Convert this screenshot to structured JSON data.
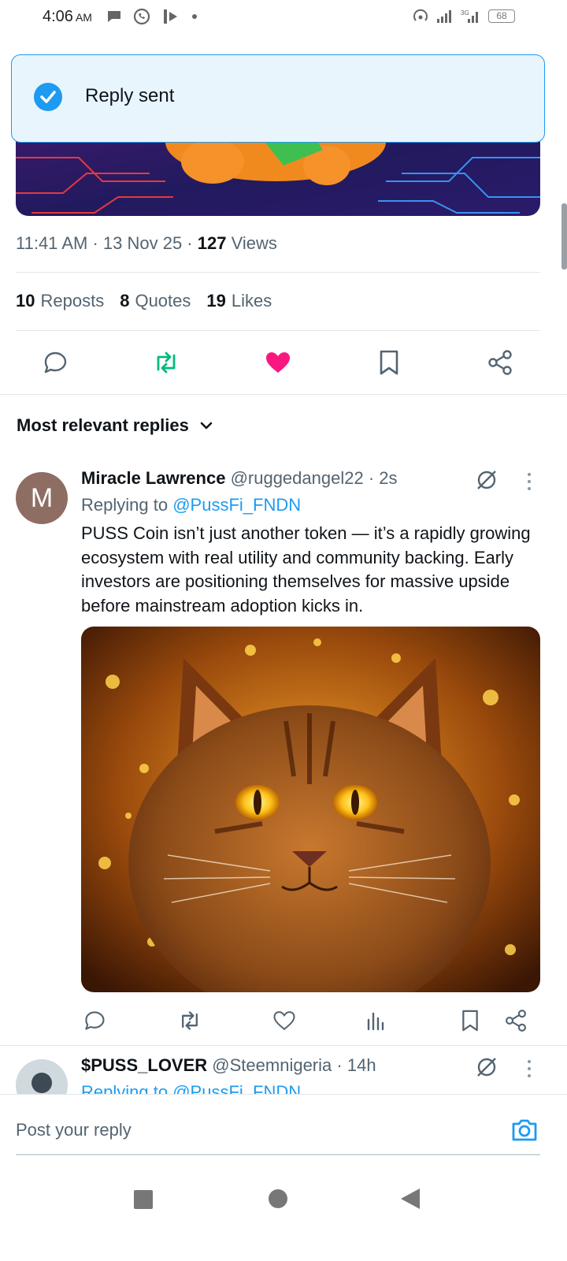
{
  "status_bar": {
    "time": "4:06",
    "ampm": "AM",
    "battery": "68",
    "network": "3G"
  },
  "toast": {
    "text": "Reply sent"
  },
  "tweet": {
    "time": "11:41 AM",
    "date": "13 Nov 25",
    "views_count": "127",
    "views_label": "Views",
    "reposts_count": "10",
    "reposts_label": "Reposts",
    "quotes_count": "8",
    "quotes_label": "Quotes",
    "likes_count": "19",
    "likes_label": "Likes"
  },
  "actions": [
    "reply-icon",
    "repost-icon",
    "like-icon",
    "bookmark-icon",
    "share-icon"
  ],
  "replies_filter": {
    "label": "Most relevant replies"
  },
  "reply1": {
    "avatar_letter": "M",
    "name": "Miracle Lawrence",
    "handle": "@ruggedangel22",
    "time": "2s",
    "replying_label": "Replying to",
    "replying_to": "@PussFi_FNDN",
    "text": "PUSS Coin isn’t just another token — it’s a rapidly growing ecosystem with real utility and community backing. Early investors are positioning themselves for massive upside before mainstream adoption kicks in."
  },
  "reply2": {
    "name": "$PUSS_LOVER",
    "handle": "@Steemnigeria",
    "time": "14h",
    "replying_label": "Replying to",
    "replying_to": "@PussFi_FNDN"
  },
  "composer": {
    "placeholder": "Post your reply"
  },
  "colors": {
    "accent": "#1d9bf0",
    "repost_green": "#00ba7c",
    "like_pink": "#f91880"
  }
}
